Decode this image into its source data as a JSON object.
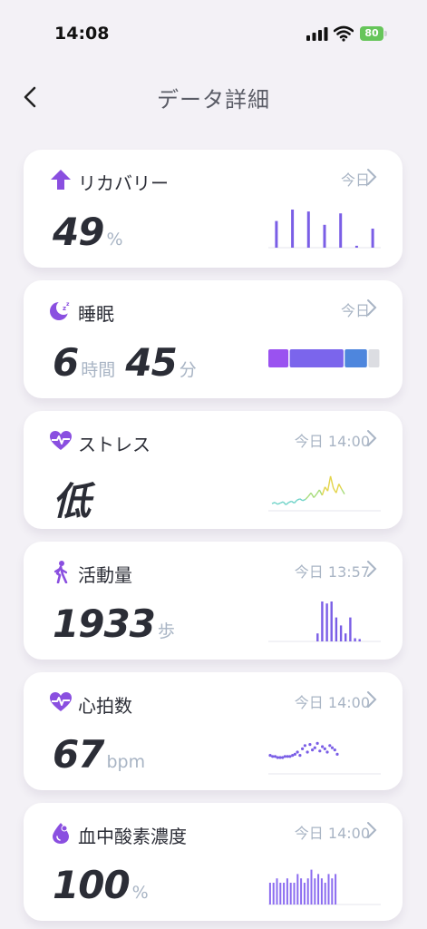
{
  "status_bar": {
    "time": "14:08",
    "battery": "80"
  },
  "header": {
    "title": "データ詳細"
  },
  "cards": {
    "recovery": {
      "title": "リカバリー",
      "time": "今日",
      "value": "49",
      "unit": "%"
    },
    "sleep": {
      "title": "睡眠",
      "time": "今日",
      "hours": "6",
      "hours_unit": "時間",
      "minutes": "45",
      "minutes_unit": "分"
    },
    "stress": {
      "title": "ストレス",
      "time": "今日 14:00",
      "value": "低"
    },
    "activity": {
      "title": "活動量",
      "time": "今日 13:57",
      "value": "1933",
      "unit": "歩"
    },
    "heart_rate": {
      "title": "心拍数",
      "time": "今日 14:00",
      "value": "67",
      "unit": "bpm"
    },
    "spo2": {
      "title": "血中酸素濃度",
      "time": "今日 14:00",
      "value": "100",
      "unit": "%"
    }
  },
  "colors": {
    "accent_purple": "#8a4fe0",
    "bar_purple": "#7a5ee6",
    "sleep_light": "#9a52f0",
    "sleep_deep": "#7b65ec",
    "sleep_rem": "#4e86dd",
    "sleep_awake": "#dcdde2",
    "spo2_bar": "#8b6cf0",
    "title_grey": "#5a5c66",
    "label_grey": "#a8b4c4",
    "battery_green": "#66c55a"
  },
  "icons": {
    "back": "chevron-left-icon",
    "recovery": "arrow-up-icon",
    "sleep": "moon-zz-icon",
    "stress": "heart-pulse-icon",
    "activity": "walking-person-icon",
    "heart_rate": "heart-pulse-icon",
    "spo2": "drop-icon",
    "chevron": "chevron-right-icon"
  },
  "chart_data": [
    {
      "type": "bar",
      "name": "recovery-mini",
      "values": [
        70,
        100,
        95,
        60,
        90,
        5,
        50
      ],
      "ylim": [
        0,
        100
      ]
    },
    {
      "type": "bar",
      "name": "sleep-stages",
      "segments": [
        {
          "stage": "light",
          "fraction": 0.19
        },
        {
          "stage": "deep",
          "fraction": 0.49
        },
        {
          "stage": "rem",
          "fraction": 0.21
        },
        {
          "stage": "awake",
          "fraction": 0.11
        }
      ]
    },
    {
      "type": "line",
      "name": "stress-mini",
      "values": [
        12,
        14,
        11,
        13,
        15,
        10,
        14,
        16,
        13,
        18,
        20,
        17,
        19,
        24,
        30,
        22,
        28,
        35,
        26,
        40,
        33,
        58,
        38,
        30,
        45,
        36,
        28
      ],
      "ylim": [
        0,
        70
      ]
    },
    {
      "type": "bar",
      "name": "activity-mini",
      "values": [
        0,
        0,
        0,
        0,
        0,
        0,
        0,
        0,
        0,
        0,
        20,
        100,
        95,
        100,
        60,
        40,
        20,
        60,
        8,
        6,
        0,
        0,
        0,
        0
      ],
      "ylim": [
        0,
        100
      ]
    },
    {
      "type": "scatter",
      "name": "heart-rate-mini",
      "values": [
        57,
        56,
        56,
        55,
        55,
        55,
        56,
        56,
        56,
        57,
        58,
        60,
        57,
        63,
        66,
        60,
        67,
        62,
        64,
        68,
        61,
        65,
        63,
        60,
        66,
        64,
        62,
        58
      ],
      "ylim": [
        40,
        80
      ]
    },
    {
      "type": "bar",
      "name": "spo2-mini",
      "values": [
        95,
        95,
        96,
        95,
        95,
        96,
        95,
        95,
        97,
        96,
        95,
        96,
        98,
        96,
        97,
        96,
        95,
        97,
        96,
        97
      ],
      "ylim": [
        90,
        100
      ]
    }
  ]
}
